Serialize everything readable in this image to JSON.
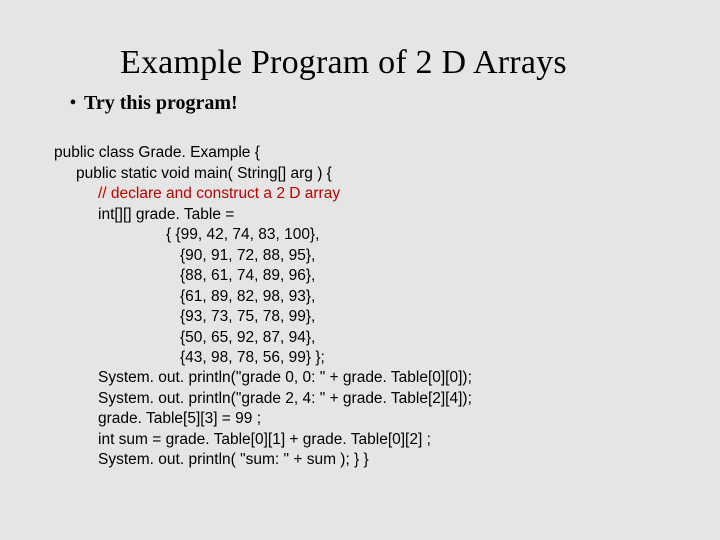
{
  "title": "Example Program of 2 D Arrays",
  "bullet": "Try this program!",
  "code": {
    "l01": "public class Grade. Example {",
    "l02": "public static void main( String[] arg ) {",
    "comment": "// declare and construct a 2 D array",
    "l03": "int[][] grade. Table =",
    "l04": "{ {99, 42, 74, 83, 100},",
    "l05": "{90, 91, 72, 88, 95},",
    "l06": "{88, 61, 74, 89, 96},",
    "l07": "{61, 89, 82, 98, 93},",
    "l08": "{93, 73, 75, 78, 99},",
    "l09": "{50, 65, 92, 87, 94},",
    "l10": "{43, 98, 78, 56, 99} };",
    "l11": "System. out. println(\"grade 0, 0: \" + grade. Table[0][0]);",
    "l12": "System. out. println(\"grade 2, 4: \" + grade. Table[2][4]);",
    "l13": "grade. Table[5][3] = 99 ;",
    "l14": "int sum = grade. Table[0][1] + grade. Table[0][2] ;",
    "l15": "System. out. println( \"sum: \" + sum ); } }"
  }
}
